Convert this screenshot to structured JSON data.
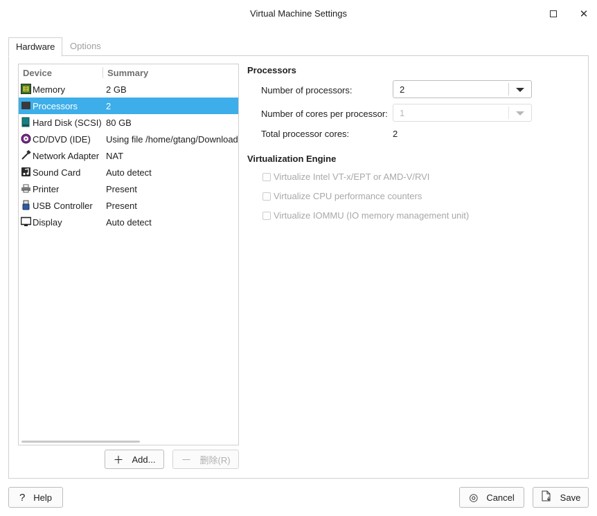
{
  "window": {
    "title": "Virtual Machine Settings"
  },
  "tabs": [
    {
      "label": "Hardware",
      "active": true
    },
    {
      "label": "Options",
      "active": false
    }
  ],
  "device_list": {
    "columns": [
      "Device",
      "Summary"
    ],
    "rows": [
      {
        "name": "Memory",
        "summary": "2 GB",
        "icon": "memory-icon"
      },
      {
        "name": "Processors",
        "summary": "2",
        "icon": "processor-icon",
        "selected": true
      },
      {
        "name": "Hard Disk (SCSI)",
        "summary": "80 GB",
        "icon": "hard-disk-icon"
      },
      {
        "name": "CD/DVD (IDE)",
        "summary": "Using file /home/gtang/Download",
        "icon": "cd-dvd-icon"
      },
      {
        "name": "Network Adapter",
        "summary": "NAT",
        "icon": "network-adapter-icon"
      },
      {
        "name": "Sound Card",
        "summary": "Auto detect",
        "icon": "sound-card-icon"
      },
      {
        "name": "Printer",
        "summary": "Present",
        "icon": "printer-icon"
      },
      {
        "name": "USB Controller",
        "summary": "Present",
        "icon": "usb-icon"
      },
      {
        "name": "Display",
        "summary": "Auto detect",
        "icon": "display-icon"
      }
    ]
  },
  "list_buttons": {
    "add": "Add...",
    "remove": "删除(R)"
  },
  "processors": {
    "title": "Processors",
    "num_processors_label": "Number of processors:",
    "num_processors_value": "2",
    "cores_label": "Number of cores per processor:",
    "cores_value": "1",
    "total_label": "Total processor cores:",
    "total_value": "2"
  },
  "virtualization": {
    "title": "Virtualization Engine",
    "options": [
      {
        "label": "Virtualize Intel VT-x/EPT or AMD-V/RVI",
        "checked": false,
        "enabled": false
      },
      {
        "label": "Virtualize CPU performance counters",
        "checked": false,
        "enabled": false
      },
      {
        "label": "Virtualize IOMMU (IO memory management unit)",
        "checked": false,
        "enabled": false
      }
    ]
  },
  "footer": {
    "help": "Help",
    "cancel": "Cancel",
    "save": "Save"
  },
  "colors": {
    "selection": "#3daee9",
    "border": "#cfcfcf",
    "disabled_text": "#a8a8a8"
  }
}
